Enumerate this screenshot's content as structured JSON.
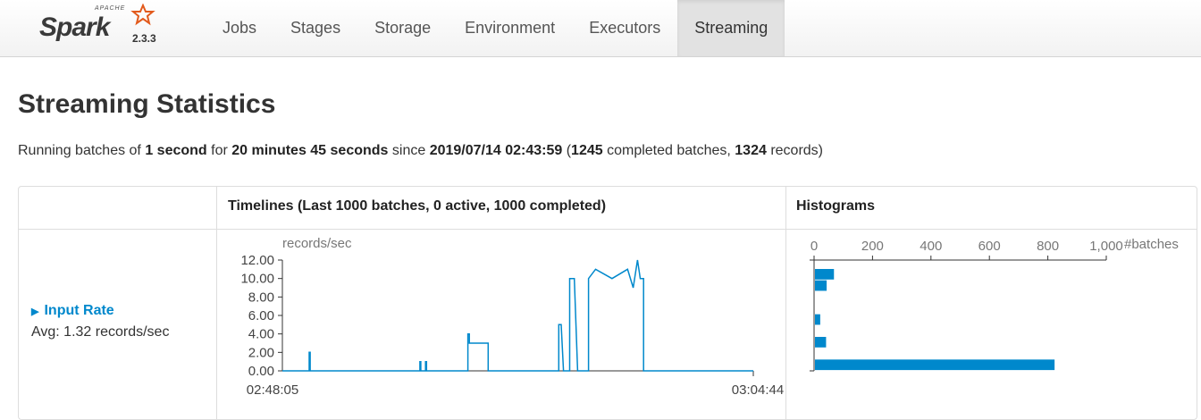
{
  "brand": {
    "apache": "APACHE",
    "name": "Spark",
    "version": "2.3.3"
  },
  "nav": [
    {
      "label": "Jobs",
      "active": false
    },
    {
      "label": "Stages",
      "active": false
    },
    {
      "label": "Storage",
      "active": false
    },
    {
      "label": "Environment",
      "active": false
    },
    {
      "label": "Executors",
      "active": false
    },
    {
      "label": "Streaming",
      "active": true
    }
  ],
  "page": {
    "title": "Streaming Statistics"
  },
  "summary": {
    "t1": "Running batches of ",
    "interval": "1 second",
    "t2": " for ",
    "duration": "20 minutes 45 seconds",
    "t3": " since ",
    "start": "2019/07/14 02:43:59",
    "t4": " (",
    "batches": "1245",
    "t5": " completed batches, ",
    "records": "1324",
    "t6": " records)"
  },
  "table": {
    "timelines_header": "Timelines (Last 1000 batches, 0 active, 1000 completed)",
    "histograms_header": "Histograms",
    "rows": [
      {
        "label": "Input Rate",
        "avg": "Avg: 1.32 records/sec"
      }
    ]
  },
  "colors": {
    "accent": "#0088cc",
    "link": "#0088cc",
    "star": "#e25a1c"
  },
  "chart_data": [
    {
      "type": "line",
      "title": "",
      "ylabel": "records/sec",
      "ylim": [
        0,
        12
      ],
      "yticks": [
        "0.00",
        "2.00",
        "4.00",
        "6.00",
        "8.00",
        "10.00",
        "12.00"
      ],
      "xticks": [
        "02:48:05",
        "03:04:44"
      ],
      "series": [
        {
          "values_x_frac": [
            0.0,
            0.057,
            0.057,
            0.059,
            0.059,
            0.292,
            0.292,
            0.294,
            0.294,
            0.304,
            0.304,
            0.306,
            0.306,
            0.394,
            0.394,
            0.397,
            0.397,
            0.437,
            0.437,
            0.44,
            0.44,
            0.587,
            0.587,
            0.592,
            0.597,
            0.6,
            0.6,
            0.61,
            0.61,
            0.62,
            0.627,
            0.632,
            0.632,
            0.65,
            0.65,
            0.665,
            0.7,
            0.733,
            0.745,
            0.754,
            0.76,
            0.767,
            0.767,
            1.0
          ],
          "values": [
            0,
            0,
            2,
            2,
            0,
            0,
            1,
            1,
            0,
            0,
            1,
            1,
            0,
            0,
            4,
            4,
            3,
            3,
            0,
            0,
            0,
            0,
            5,
            5,
            0,
            0,
            0,
            0,
            10,
            10,
            0,
            0,
            0,
            0,
            10,
            11,
            10,
            11,
            9,
            12,
            10,
            10,
            0,
            0
          ]
        }
      ]
    },
    {
      "type": "bar",
      "orientation": "horizontal",
      "xlabel": "#batches",
      "xlim": [
        0,
        1000
      ],
      "xticks": [
        "0",
        "200",
        "400",
        "600",
        "800",
        "1,000"
      ],
      "bins": [
        {
          "value": 65
        },
        {
          "value": 40
        },
        {
          "value": 0
        },
        {
          "value": 0
        },
        {
          "value": 18
        },
        {
          "value": 0
        },
        {
          "value": 38
        },
        {
          "value": 0
        },
        {
          "value": 820
        }
      ]
    }
  ]
}
